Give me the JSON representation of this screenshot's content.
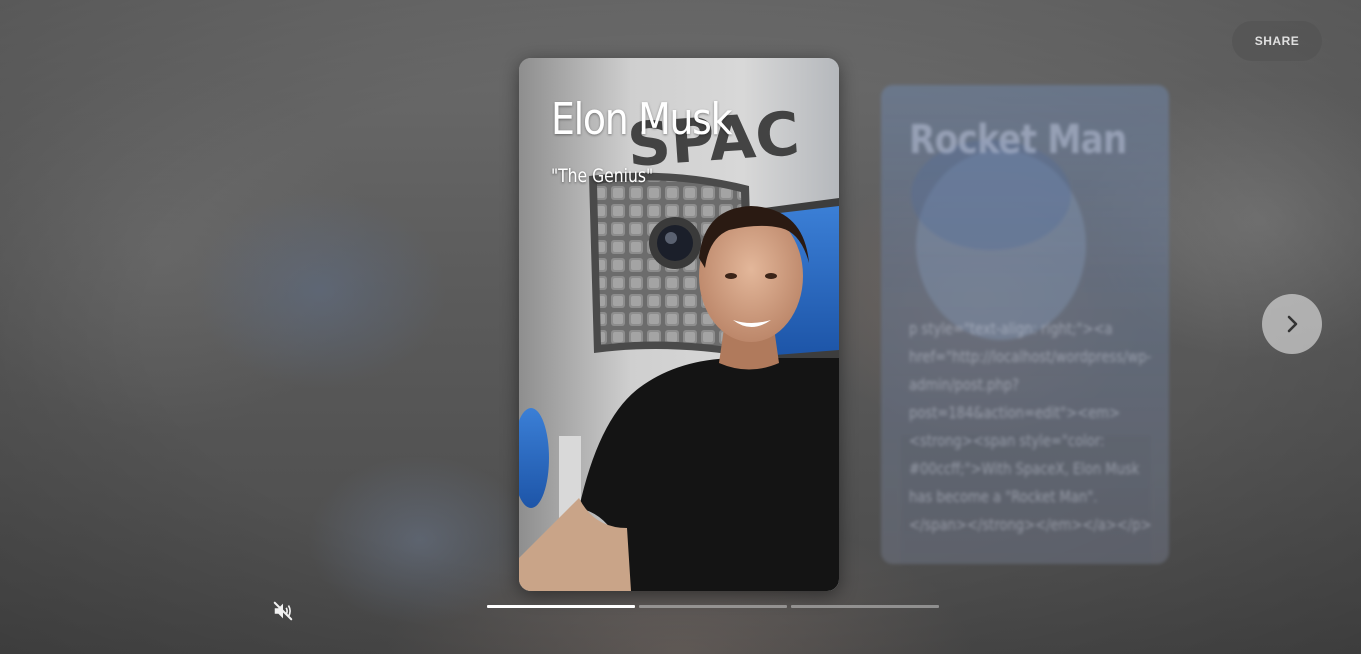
{
  "toolbar": {
    "share_label": "SHARE"
  },
  "current_story": {
    "title": "Elon Musk",
    "subtitle": "\"The Genius\""
  },
  "next_story": {
    "title": "Rocket Man",
    "body": "p style=\"text-align: right;\"><a href=\"http://localhost/wordpress/wp-admin/post.php?post=184&action=edit\"><em><strong><span style=\"color: #00ccff;\">With SpaceX, Elon Musk has become a \"Rocket Man\".</span></strong></em></a></p>"
  },
  "controls": {
    "next_icon": "chevron-right-icon",
    "mute_icon": "volume-muted-icon"
  },
  "progress": [
    1,
    0,
    0
  ],
  "colors": {
    "share_bg": "#555555",
    "progress_active": "#ffffff",
    "progress_inactive": "#c8c8c8",
    "arrow_bg": "#c8c8c8"
  }
}
